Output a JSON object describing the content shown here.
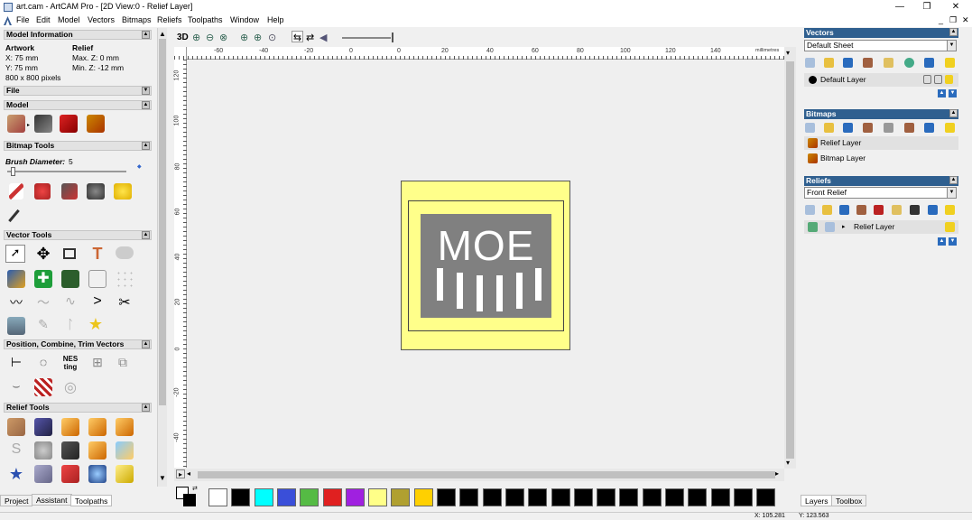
{
  "window": {
    "title": "art.cam - ArtCAM Pro - [2D View:0 - Relief Layer]",
    "minimize": "—",
    "restore": "❐",
    "close": "✕",
    "mdi_min": "_",
    "mdi_restore": "❐",
    "mdi_close": "✕"
  },
  "menus": [
    "File",
    "Edit",
    "Model",
    "Vectors",
    "Bitmaps",
    "Reliefs",
    "Toolpaths",
    "Window",
    "Help"
  ],
  "left": {
    "model_info": {
      "title": "Model Information",
      "artwork_label": "Artwork",
      "x": "X: 75 mm",
      "y": "Y: 75 mm",
      "pixels": "800 x 800 pixels",
      "relief_label": "Relief",
      "maxz": "Max. Z: 0 mm",
      "minz": "Min. Z: -12 mm"
    },
    "file_title": "File",
    "model_title": "Model",
    "bitmap_tools_title": "Bitmap Tools",
    "brush_label": "Brush Diameter:",
    "brush_value": "5",
    "brush_level": 0.03,
    "vector_tools_title": "Vector Tools",
    "position_title": "Position, Combine, Trim Vectors",
    "relief_tools_title": "Relief Tools",
    "tabs": [
      "Project",
      "Assistant",
      "Toolpaths"
    ]
  },
  "view": {
    "btn_3d": "3D",
    "ruler_unit": "millimetres",
    "x_ticks": [
      "-60",
      "-40",
      "-20",
      "0",
      "20",
      "40",
      "60",
      "80",
      "100",
      "120",
      "140"
    ],
    "y_ticks": [
      "120",
      "100",
      "80",
      "60",
      "40",
      "20",
      "0",
      "-20",
      "-40"
    ],
    "artwork_text": "MOE"
  },
  "palette": {
    "colors": [
      "#ffffff",
      "#000000",
      "#00ffff",
      "#3a4fd9",
      "#55bb44",
      "#e02020",
      "#a020e0",
      "#ffff88",
      "#b0a030",
      "#ffd000",
      "#000000",
      "#000000",
      "#000000",
      "#000000",
      "#000000",
      "#000000",
      "#000000",
      "#000000",
      "#000000",
      "#000000",
      "#000000",
      "#000000",
      "#000000",
      "#000000",
      "#000000"
    ]
  },
  "right": {
    "vectors": {
      "title": "Vectors",
      "sheet": "Default Sheet",
      "layer": "Default Layer"
    },
    "bitmaps": {
      "title": "Bitmaps",
      "layers": [
        "Relief Layer",
        "Bitmap Layer"
      ]
    },
    "reliefs": {
      "title": "Reliefs",
      "selected": "Front Relief",
      "layer": "Relief Layer"
    },
    "tabs": [
      "Layers",
      "Toolbox"
    ]
  },
  "status": {
    "x": "X: 105.281",
    "y": "Y: 123.563"
  }
}
